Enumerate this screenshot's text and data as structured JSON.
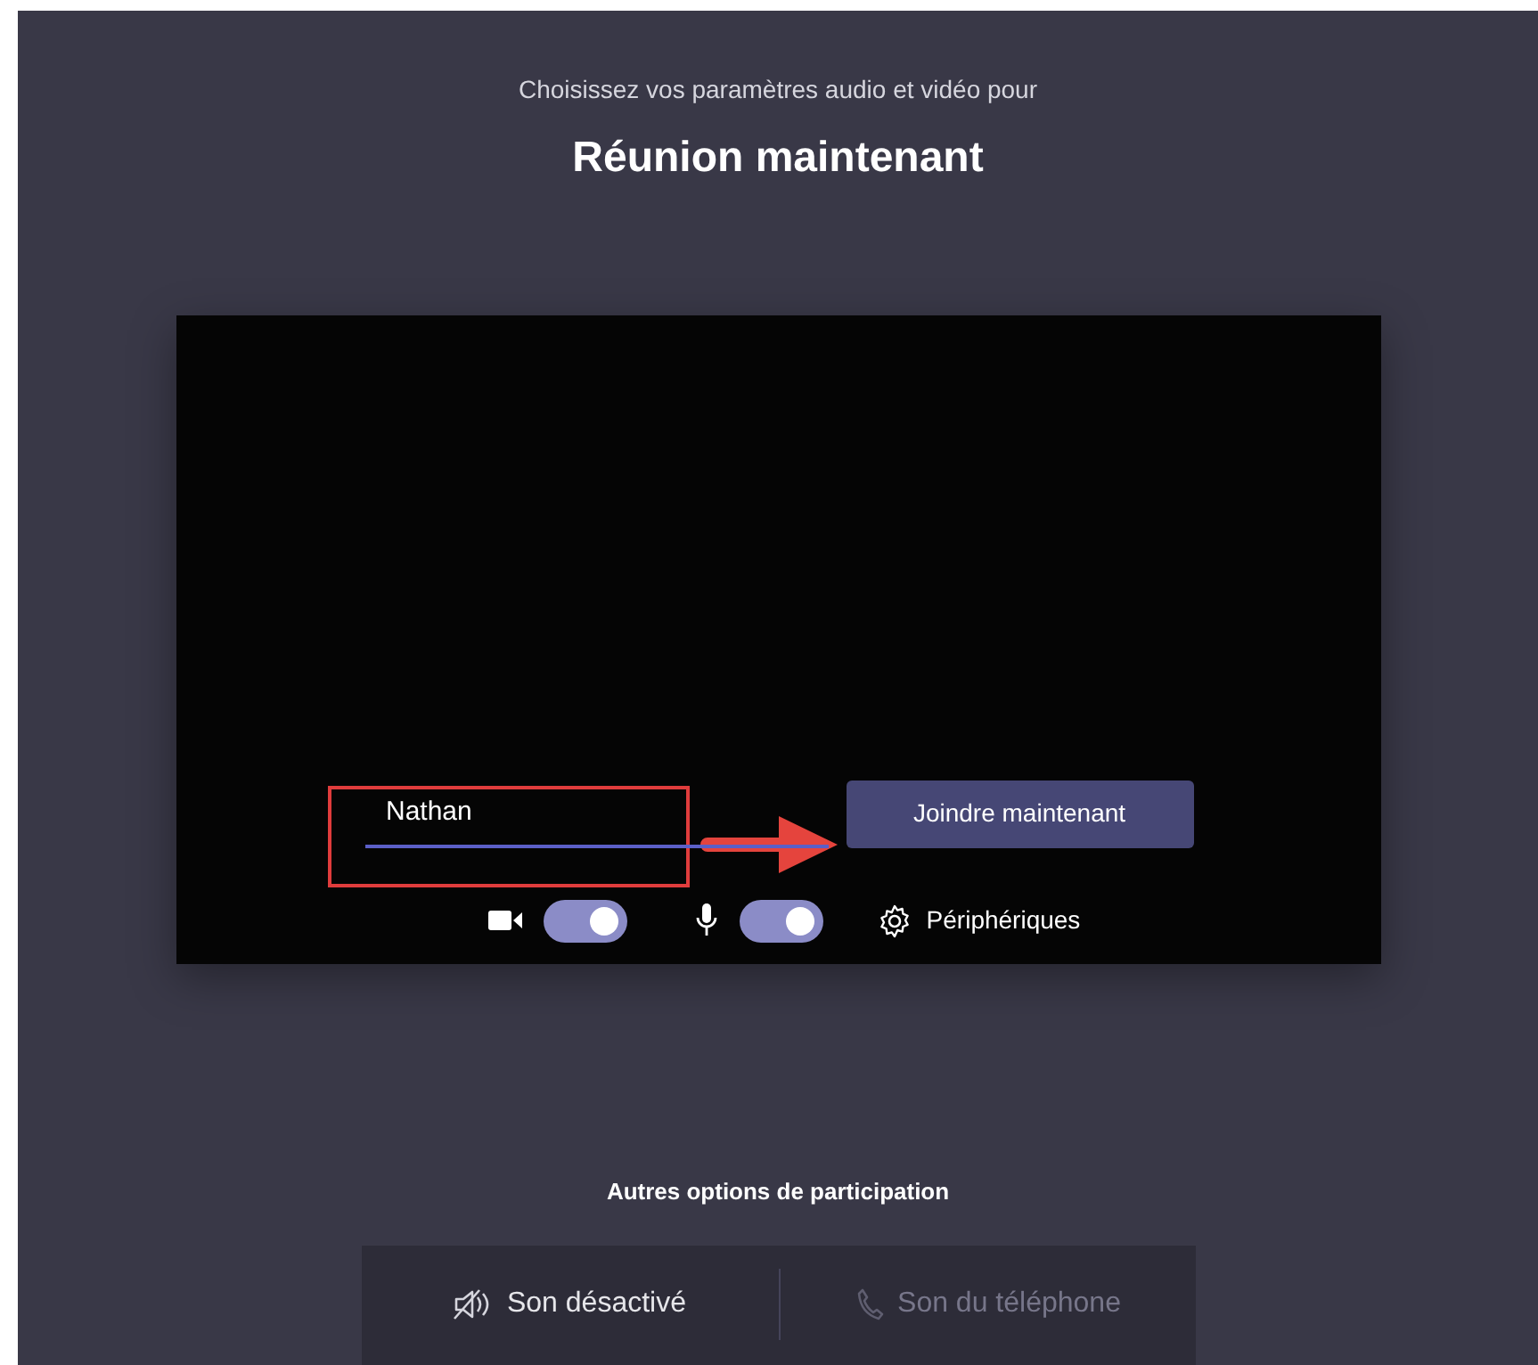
{
  "header": {
    "subtitle": "Choisissez vos paramètres audio et vidéo pour",
    "title": "Réunion maintenant"
  },
  "preview": {
    "name_field": {
      "value": "Nathan"
    },
    "join_button": "Joindre maintenant",
    "toggles": [
      {
        "kind": "camera",
        "on": true
      },
      {
        "kind": "microphone",
        "on": true
      }
    ],
    "devices_button": "Périphériques",
    "highlight_box": true,
    "arrow": true
  },
  "other_options": {
    "title": "Autres options de participation",
    "options": [
      {
        "kind": "audio-off",
        "label": "Son désactivé",
        "disabled": false
      },
      {
        "kind": "phone",
        "label": "Son du téléphone",
        "disabled": true
      }
    ]
  }
}
